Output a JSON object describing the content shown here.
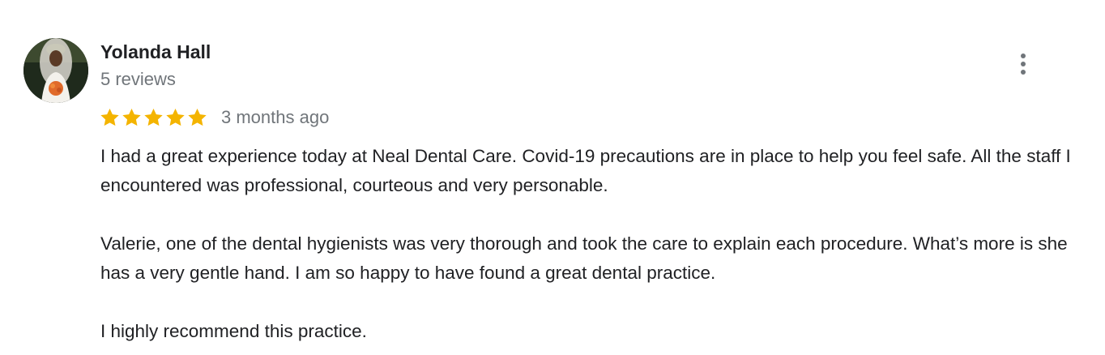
{
  "review": {
    "author": "Yolanda Hall",
    "review_count": "5 reviews",
    "rating": 5,
    "rating_max": 5,
    "time": "3 months ago",
    "star_color": "#f4b400",
    "menu_icon": "more-vert-icon",
    "paragraphs": [
      "I had a great experience today at Neal Dental Care. Covid-19 precautions are in place to help you feel safe. All the staff I encountered was professional, courteous and very personable.",
      "Valerie, one of the dental hygienists was very thorough and took the care to explain each procedure. What’s more is she has a very gentle hand. I am so happy to have found a great dental practice.",
      "I highly recommend this practice."
    ]
  }
}
